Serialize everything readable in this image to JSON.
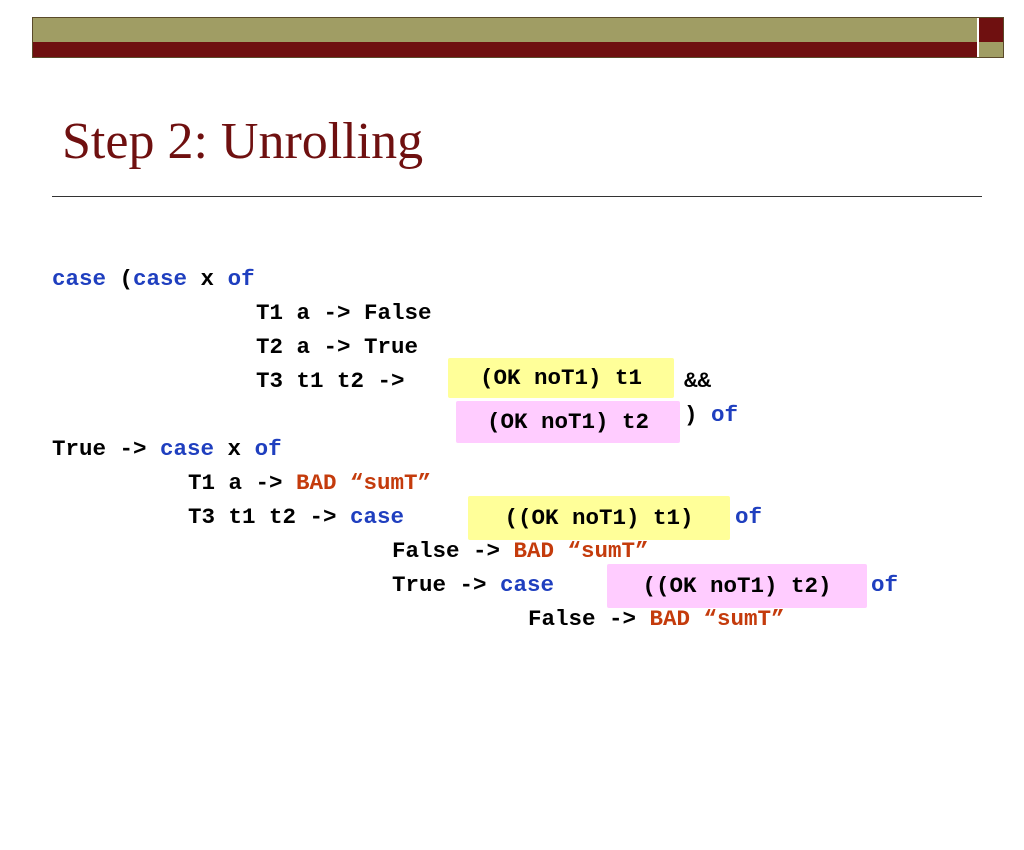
{
  "slide": {
    "title": "Step 2: Unrolling"
  },
  "code": {
    "l1": {
      "kw1": "case",
      "t1": " (",
      "kw2": "case",
      "t2": " x ",
      "kw3": "of"
    },
    "l2": {
      "t1": "T1 a -> False"
    },
    "l3": {
      "t1": "T2 a -> True"
    },
    "l4": {
      "t1": "T3 t1 t2 ->",
      "t2": "&&"
    },
    "l5": {
      "t1": ")",
      "kw1": "of"
    },
    "l6": {
      "t1": "True -> ",
      "kw1": "case",
      "t2": " x ",
      "kw2": "of"
    },
    "l7": {
      "t1": "T1 a -> ",
      "bad": "BAD “sumT”"
    },
    "l8": {
      "t1": "T3 t1 t2 -> ",
      "kw1": "case",
      "kw2": "of"
    },
    "l9": {
      "t1": "False -> ",
      "bad": "BAD “sumT”"
    },
    "l10": {
      "t1": "True -> ",
      "kw1": "case",
      "kw2": "of"
    },
    "l11": {
      "t1": "False -> ",
      "bad": "BAD “sumT”"
    }
  },
  "highlights": {
    "box1": "(OK noT1) t1",
    "box2": "(OK noT1) t2",
    "box3": "((OK noT1) t1)",
    "box4": "((OK noT1) t2)"
  },
  "colors": {
    "title": "#6f1010",
    "keyword": "#1f3fbf",
    "bad": "#c43b0c",
    "highlight_yellow": "#ffff99",
    "highlight_pink": "#ffccff",
    "bar_olive": "#a09d64",
    "bar_maroon": "#6f1010"
  }
}
